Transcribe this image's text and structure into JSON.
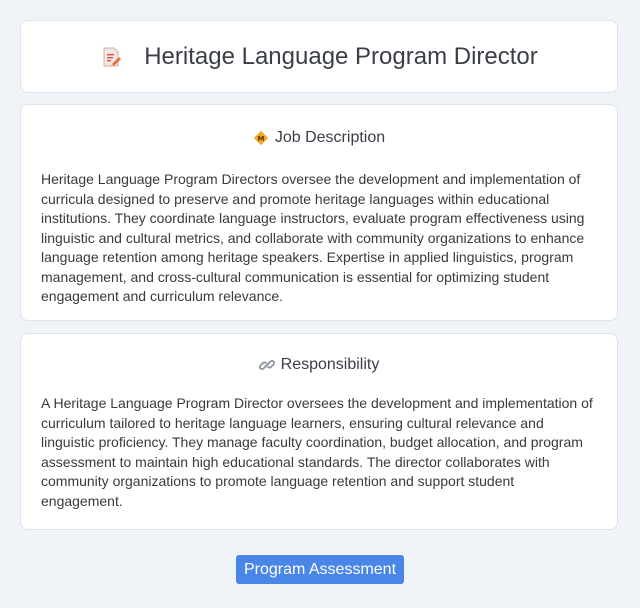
{
  "header": {
    "title": "Heritage Language Program Director",
    "icon": "memo-pencil-icon"
  },
  "job_description": {
    "heading": "Job Description",
    "icon": "diamond-badge-icon",
    "text": "Heritage Language Program Directors oversee the development and implementation of curricula designed to preserve and promote heritage languages within educational institutions. They coordinate language instructors, evaluate program effectiveness using linguistic and cultural metrics, and collaborate with community organizations to enhance language retention among heritage speakers. Expertise in applied linguistics, program management, and cross-cultural communication is essential for optimizing student engagement and curriculum relevance."
  },
  "responsibility": {
    "heading": "Responsibility",
    "icon": "link-icon",
    "text": "A Heritage Language Program Director oversees the development and implementation of curriculum tailored to heritage language learners, ensuring cultural relevance and linguistic proficiency. They manage faculty coordination, budget allocation, and program assessment to maintain high educational standards. The director collaborates with community organizations to promote language retention and support student engagement."
  },
  "action": {
    "label": "Program Assessment"
  },
  "colors": {
    "background": "#f0f3f8",
    "card": "#ffffff",
    "accent": "#4a86e8"
  }
}
